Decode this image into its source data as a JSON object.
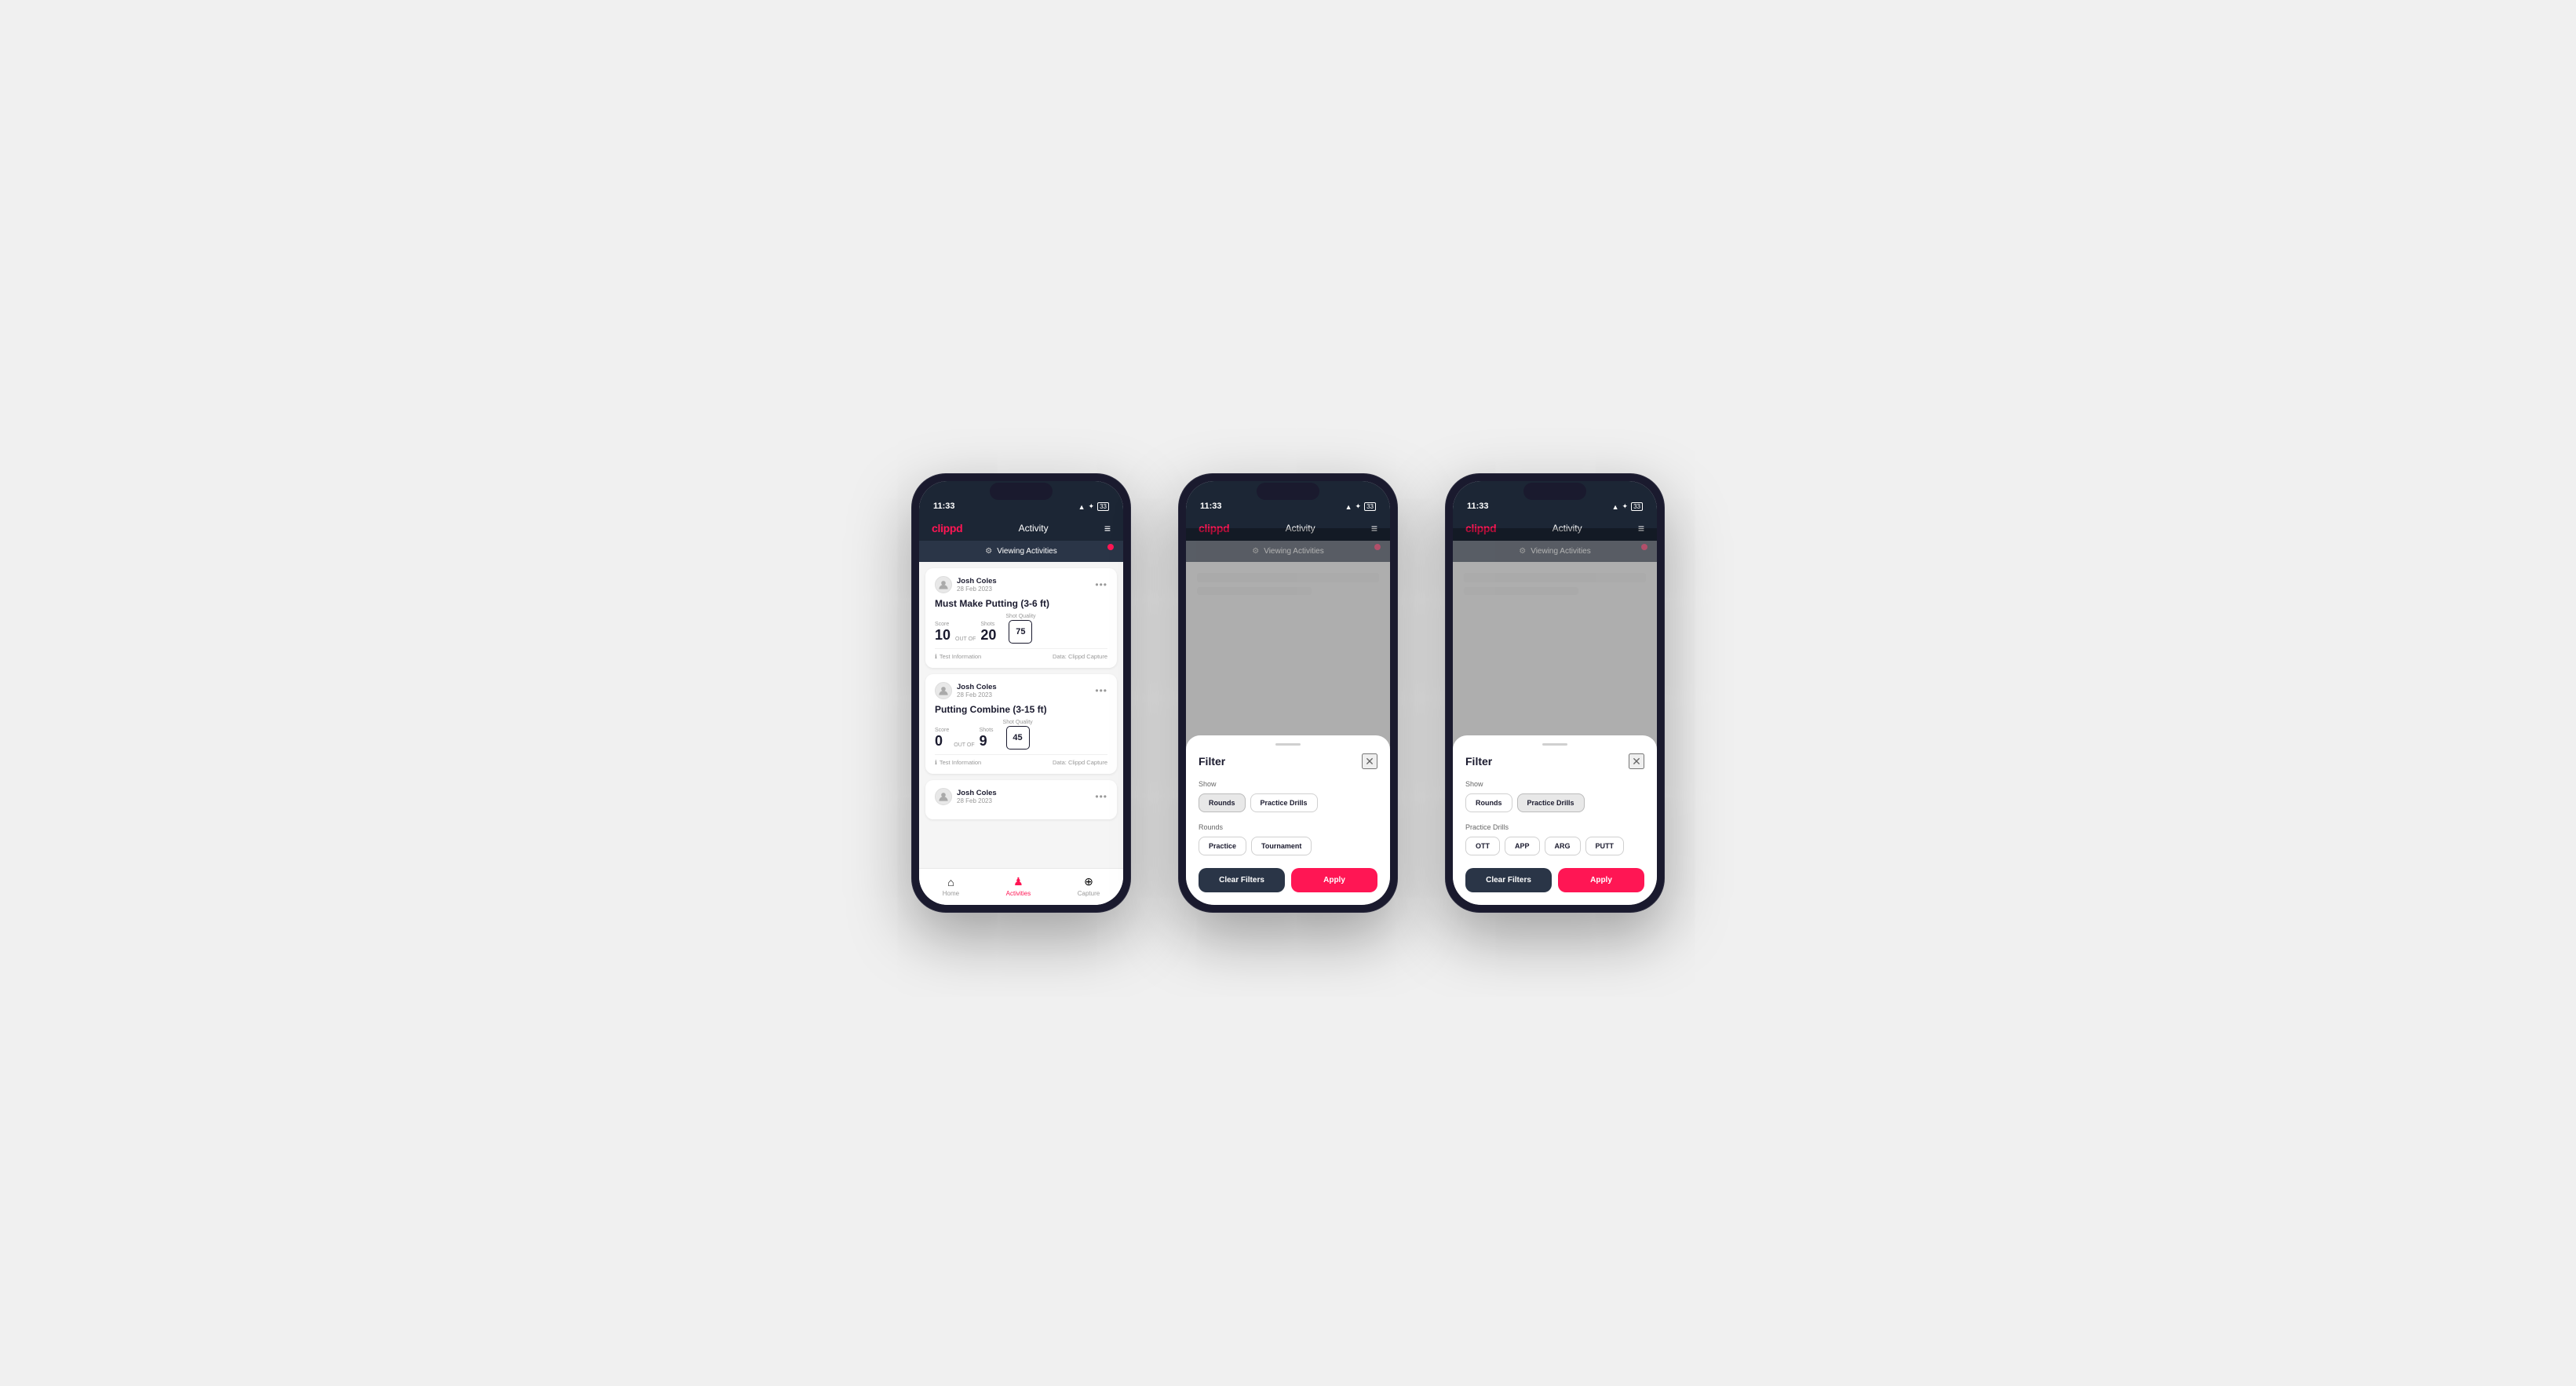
{
  "phones": [
    {
      "id": "phone-1",
      "statusBar": {
        "time": "11:33",
        "icons": "▲ ✦ ⬛"
      },
      "navBar": {
        "logo": "clippd",
        "title": "Activity",
        "menuIcon": "≡"
      },
      "viewingBar": {
        "icon": "⚙",
        "label": "Viewing Activities"
      },
      "activities": [
        {
          "userName": "Josh Coles",
          "userDate": "28 Feb 2023",
          "title": "Must Make Putting (3-6 ft)",
          "scoreLabel": "Score",
          "scoreValue": "10",
          "outOf": "OUT OF",
          "shotsLabel": "Shots",
          "shotsValue": "20",
          "qualityLabel": "Shot Quality",
          "qualityValue": "75",
          "testInfo": "Test Information",
          "dataSource": "Data: Clippd Capture"
        },
        {
          "userName": "Josh Coles",
          "userDate": "28 Feb 2023",
          "title": "Putting Combine (3-15 ft)",
          "scoreLabel": "Score",
          "scoreValue": "0",
          "outOf": "OUT OF",
          "shotsLabel": "Shots",
          "shotsValue": "9",
          "qualityLabel": "Shot Quality",
          "qualityValue": "45",
          "testInfo": "Test Information",
          "dataSource": "Data: Clippd Capture"
        }
      ],
      "tabBar": {
        "home": "Home",
        "activities": "Activities",
        "capture": "Capture"
      }
    }
  ],
  "filter1": {
    "title": "Filter",
    "showLabel": "Show",
    "showButtons": [
      "Rounds",
      "Practice Drills"
    ],
    "activeShow": "Rounds",
    "roundsLabel": "Rounds",
    "roundsButtons": [
      "Practice",
      "Tournament"
    ],
    "activeRound": "",
    "clearLabel": "Clear Filters",
    "applyLabel": "Apply"
  },
  "filter2": {
    "title": "Filter",
    "showLabel": "Show",
    "showButtons": [
      "Rounds",
      "Practice Drills"
    ],
    "activeShow": "Practice Drills",
    "drillsLabel": "Practice Drills",
    "drillsButtons": [
      "OTT",
      "APP",
      "ARG",
      "PUTT"
    ],
    "activeDrill": "",
    "clearLabel": "Clear Filters",
    "applyLabel": "Apply"
  },
  "status": {
    "time": "11:33",
    "logo": "clippd",
    "navTitle": "Activity",
    "viewingLabel": "Viewing Activities"
  }
}
